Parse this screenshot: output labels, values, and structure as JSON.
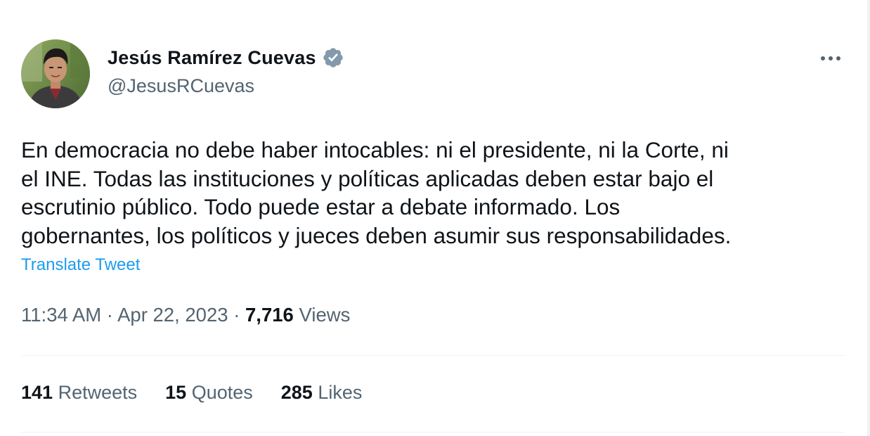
{
  "author": {
    "name": "Jesús Ramírez Cuevas",
    "handle": "@JesusRCuevas",
    "verified_color": "#829aab"
  },
  "tweet": {
    "text": "En democracia no debe haber intocables: ni el presidente, ni la Corte, ni\nel INE. Todas las instituciones y políticas aplicadas deben estar bajo el\nescrutinio público. Todo puede estar a debate informado. Los\ngobernantes, los políticos y jueces deben asumir sus responsabilidades.",
    "translate_label": "Translate Tweet"
  },
  "meta": {
    "time": "11:34 AM",
    "separator": " · ",
    "date": "Apr 22, 2023",
    "views_count": "7,716",
    "views_label": "Views"
  },
  "stats": {
    "retweets_count": "141",
    "retweets_label": "Retweets",
    "quotes_count": "15",
    "quotes_label": "Quotes",
    "likes_count": "285",
    "likes_label": "Likes"
  },
  "icons": {
    "verified": "verified-badge-icon",
    "more": "more-options-icon"
  },
  "colors": {
    "link": "#1d9bf0",
    "secondary_text": "#536471",
    "primary_text": "#0f1419"
  }
}
